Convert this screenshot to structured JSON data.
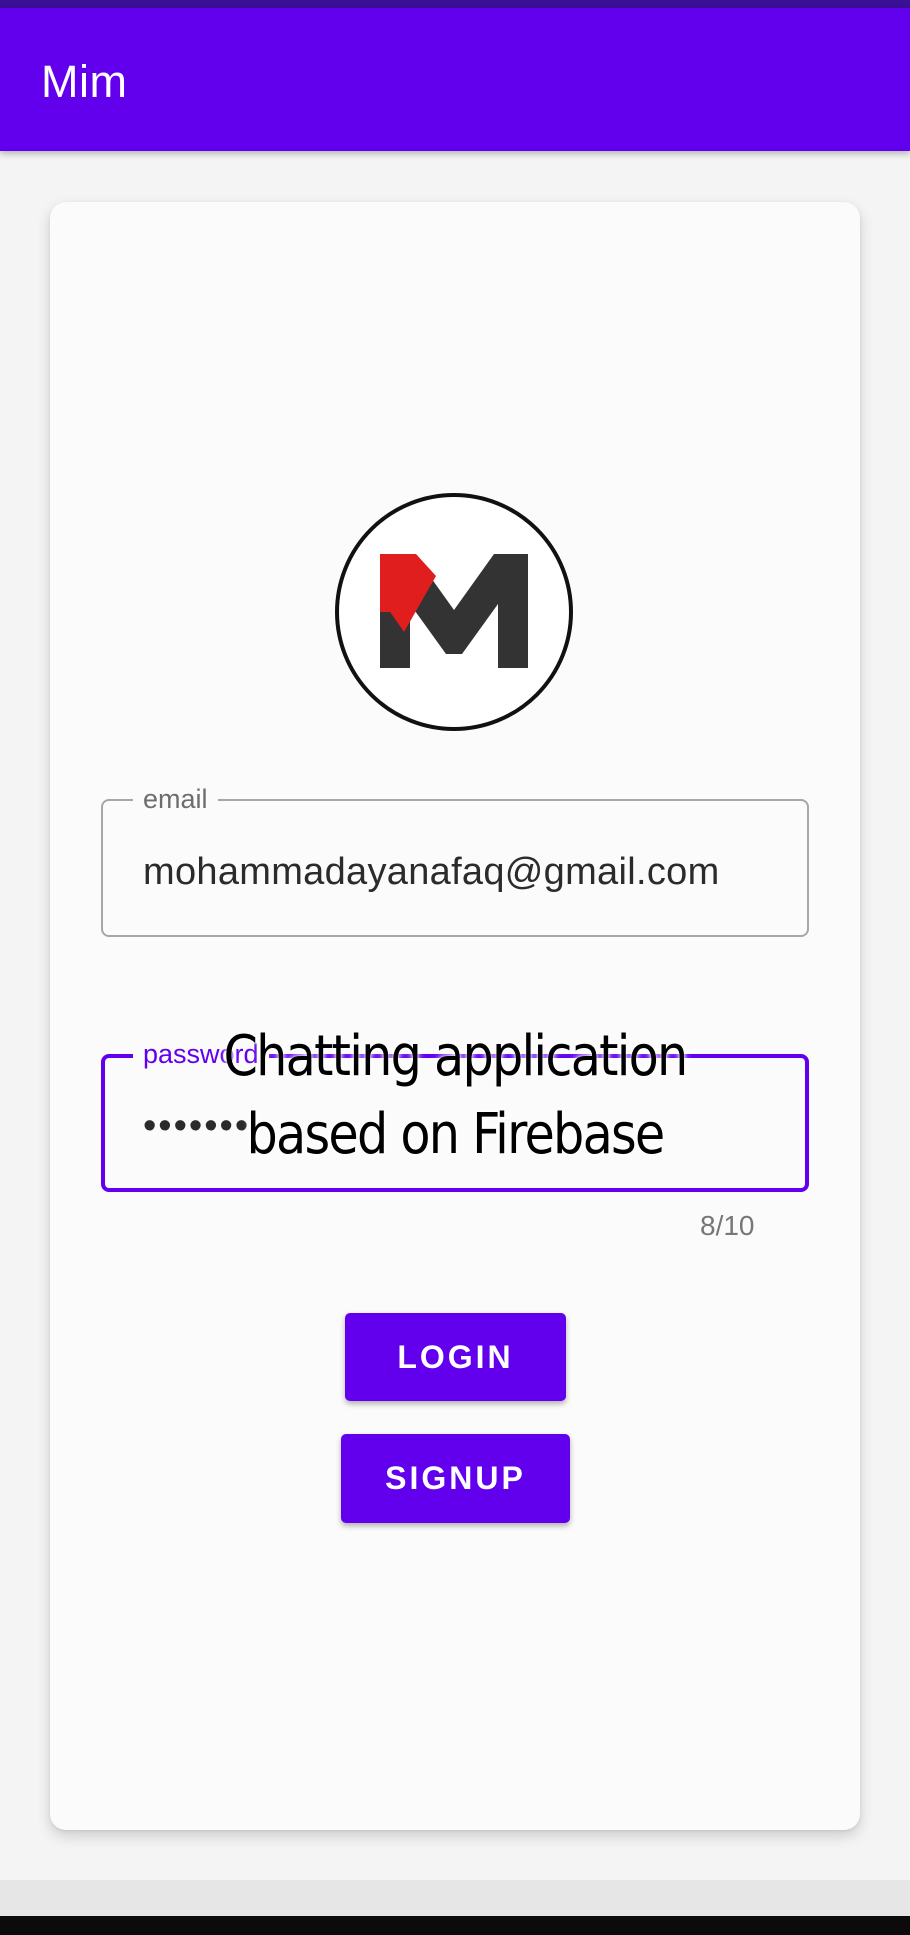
{
  "app_bar": {
    "title": "Mim",
    "color": "#6200ee"
  },
  "logo": {
    "name": "m-logo-icon",
    "letter": "M",
    "colors": {
      "red": "#e01e1e",
      "dark": "#333333"
    }
  },
  "form": {
    "email": {
      "label": "email",
      "value": "mohammadayanafaq@gmail.com"
    },
    "password": {
      "label": "password",
      "value": "•••••••",
      "counter": "8/10"
    }
  },
  "buttons": {
    "login": "LOGIN",
    "signup": "SIGNUP"
  },
  "overlay_caption": {
    "line1": "Chatting application",
    "line2": "based on Firebase"
  }
}
